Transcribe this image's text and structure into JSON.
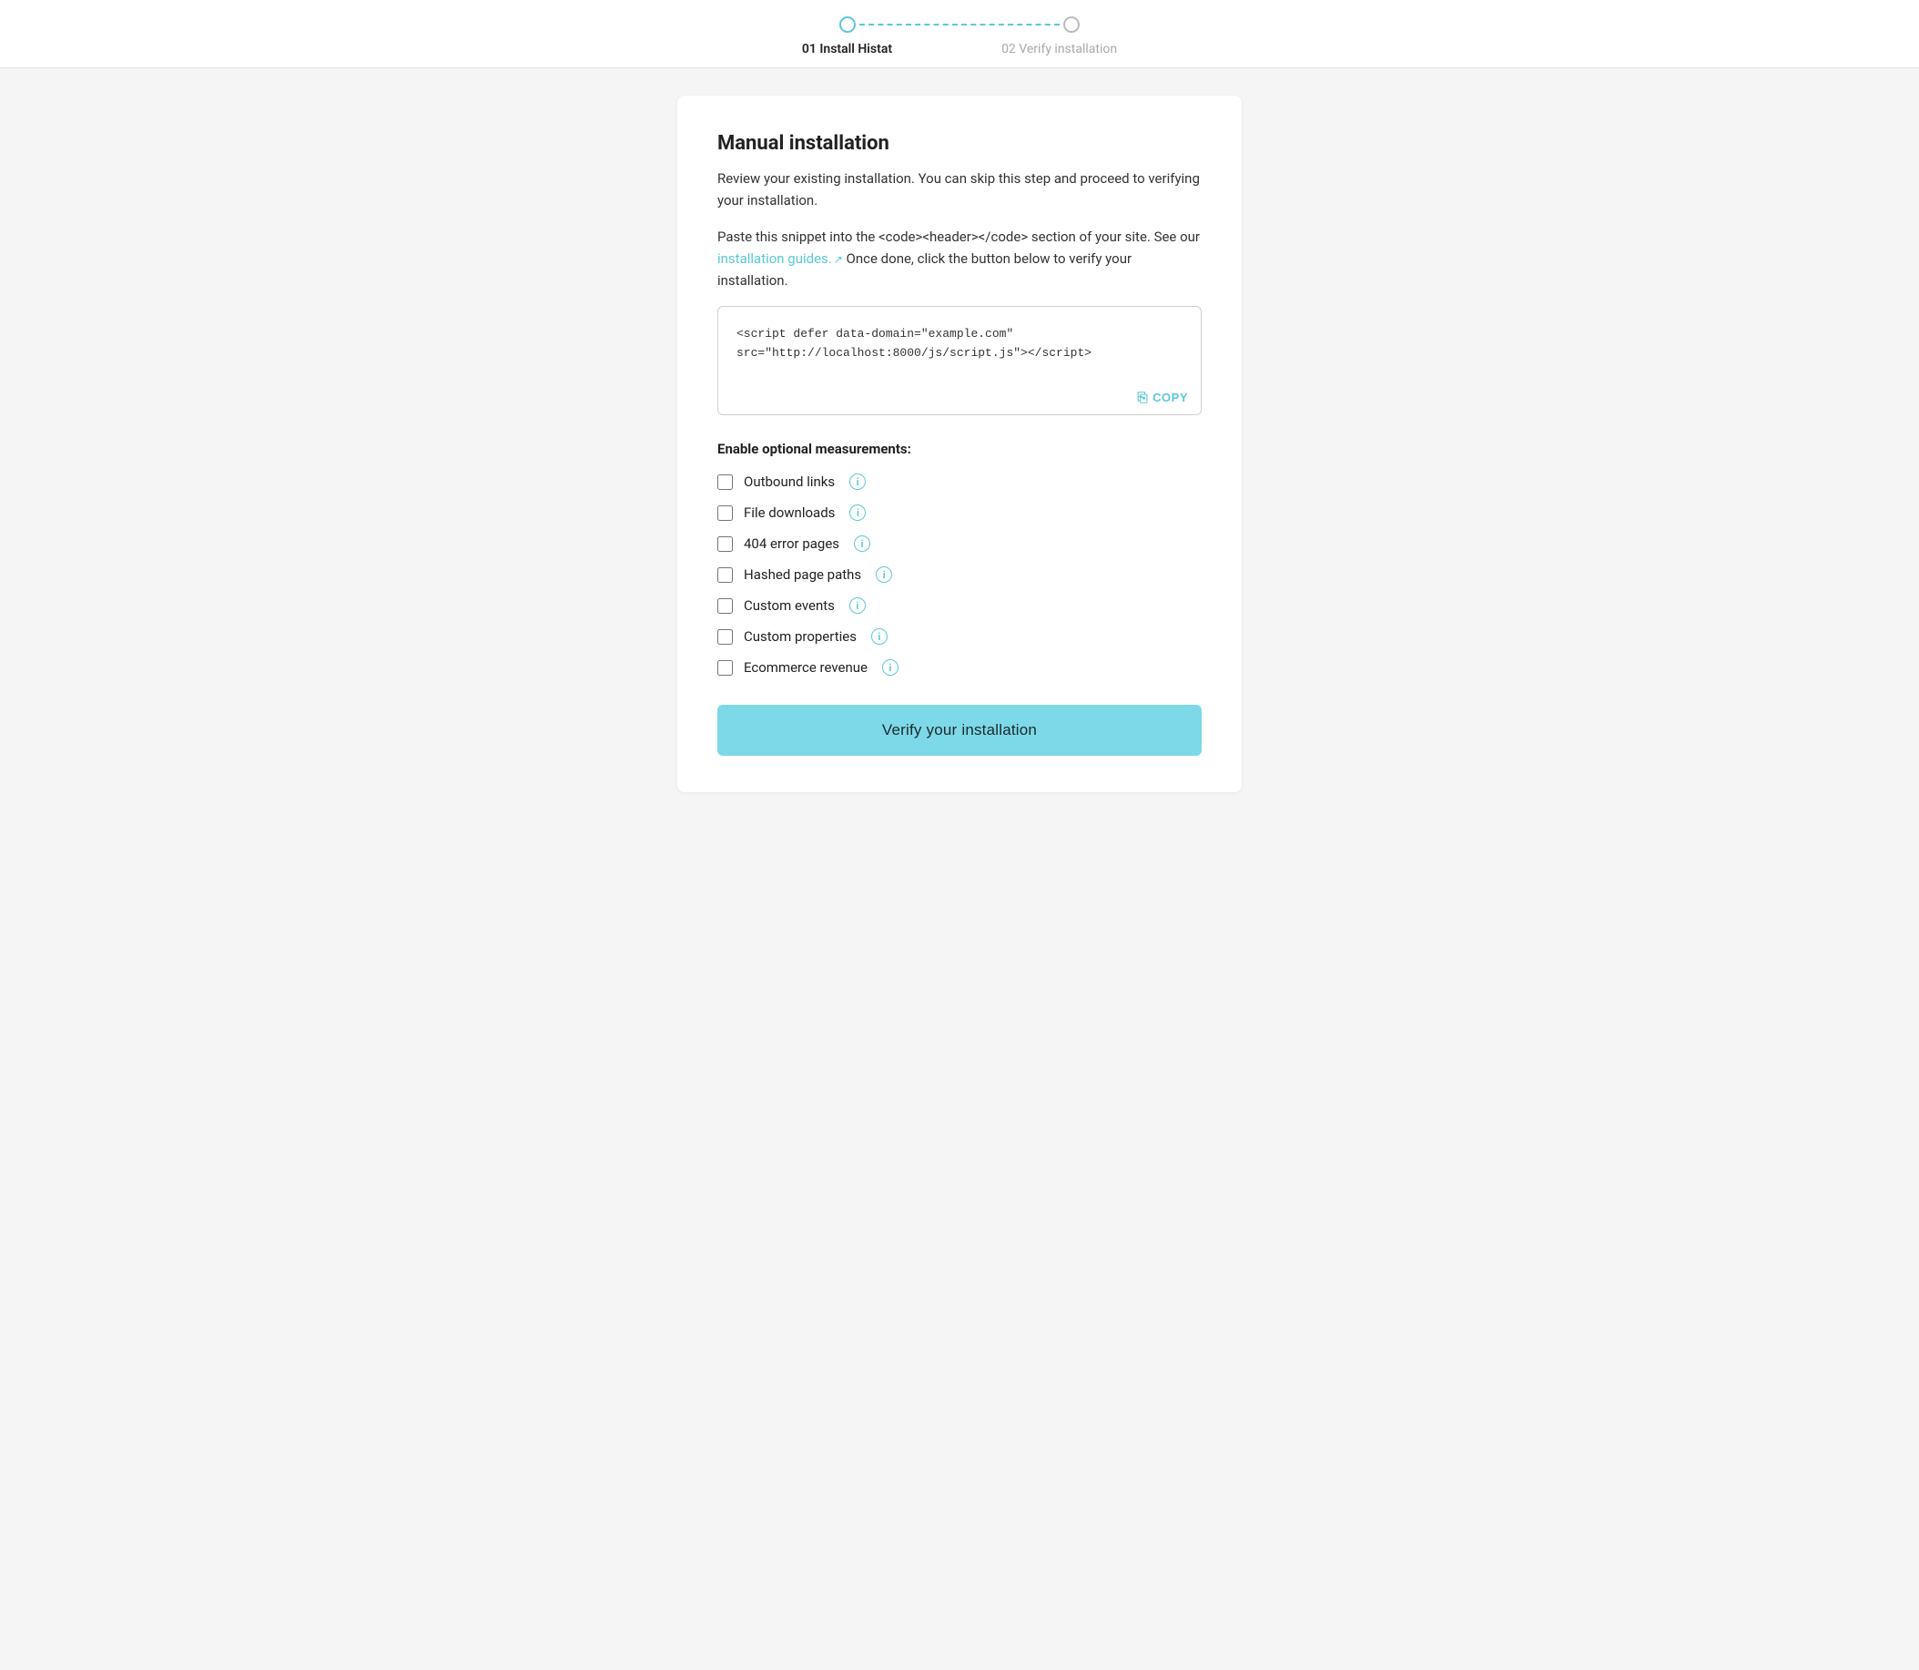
{
  "stepper": {
    "step1": {
      "label": "01 Install Histat",
      "active": true
    },
    "step2": {
      "label": "02 Verify installation",
      "active": false
    }
  },
  "main": {
    "title": "Manual installation",
    "description1": "Review your existing installation. You can skip this step and proceed to verifying your installation.",
    "description2_prefix": "Paste this snippet into the <code><header></code> section of your site. See our ",
    "description2_link": "installation guides.",
    "description2_suffix": " Once done, click the button below to verify your installation.",
    "code_snippet": "<script defer data-domain=\"example.com\"\nsrc=\"http://localhost:8000/js/script.js\"></script>",
    "copy_label": "COPY",
    "optional_title": "Enable optional measurements:",
    "checkboxes": [
      {
        "id": "outbound",
        "label": "Outbound links",
        "checked": false
      },
      {
        "id": "downloads",
        "label": "File downloads",
        "checked": false
      },
      {
        "id": "404",
        "label": "404 error pages",
        "checked": false
      },
      {
        "id": "hashed",
        "label": "Hashed page paths",
        "checked": false
      },
      {
        "id": "custom-events",
        "label": "Custom events",
        "checked": false
      },
      {
        "id": "custom-props",
        "label": "Custom properties",
        "checked": false
      },
      {
        "id": "ecommerce",
        "label": "Ecommerce revenue",
        "checked": false
      }
    ],
    "verify_button": "Verify your installation"
  }
}
